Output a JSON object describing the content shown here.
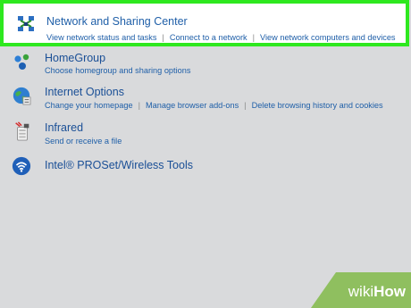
{
  "items": [
    {
      "title": "Network and Sharing Center",
      "links": [
        "View network status and tasks",
        "Connect to a network",
        "View network computers and devices"
      ],
      "icon": "network-center-icon"
    },
    {
      "title": "HomeGroup",
      "links": [
        "Choose homegroup and sharing options"
      ],
      "icon": "homegroup-icon"
    },
    {
      "title": "Internet Options",
      "links": [
        "Change your homepage",
        "Manage browser add-ons",
        "Delete browsing history and cookies"
      ],
      "icon": "internet-options-icon"
    },
    {
      "title": "Infrared",
      "links": [
        "Send or receive a file"
      ],
      "icon": "infrared-icon"
    },
    {
      "title": "Intel® PROSet/Wireless Tools",
      "links": [],
      "icon": "intel-wireless-icon"
    }
  ],
  "watermark": {
    "part1": "wiki",
    "part2": "How"
  },
  "colors": {
    "highlight": "#2ee81f",
    "link": "#1f5fa8",
    "background": "#d9dadc",
    "watermark": "#8fbf5f"
  }
}
